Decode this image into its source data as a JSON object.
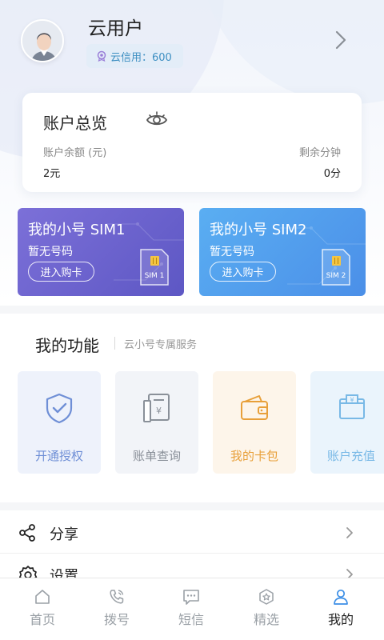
{
  "profile": {
    "username": "云用户",
    "credit_text": "云信用：600"
  },
  "overview": {
    "title": "账户总览",
    "balance_label": "账户余额 (元)",
    "balance_value": "2元",
    "minutes_label": "剩余分钟",
    "minutes_value": "0分"
  },
  "sim_cards": [
    {
      "title": "我的小号 SIM1",
      "status": "暂无号码",
      "button": "进入购卡",
      "chip_label": "SIM 1"
    },
    {
      "title": "我的小号 SIM2",
      "status": "暂无号码",
      "button": "进入购卡",
      "chip_label": "SIM 2"
    }
  ],
  "functions": {
    "title": "我的功能",
    "subtitle": "云小号专属服务",
    "items": [
      {
        "label": "开通授权",
        "icon": "shield-check-icon",
        "color": "#6f8fd6",
        "bg": "#eef2fb"
      },
      {
        "label": "账单查询",
        "icon": "bill-icon",
        "color": "#8a9099",
        "bg": "#f2f4f8"
      },
      {
        "label": "我的卡包",
        "icon": "wallet-icon",
        "color": "#e8a03a",
        "bg": "#fdf5ea"
      },
      {
        "label": "账户充值",
        "icon": "recharge-icon",
        "color": "#79b9e6",
        "bg": "#eaf4fc"
      }
    ]
  },
  "menu": [
    {
      "label": "分享",
      "icon": "share-icon"
    },
    {
      "label": "设置",
      "icon": "settings-icon"
    }
  ],
  "tabbar": {
    "active": "我的",
    "items": [
      {
        "label": "首页",
        "icon": "home-icon"
      },
      {
        "label": "拨号",
        "icon": "phone-icon"
      },
      {
        "label": "短信",
        "icon": "message-icon"
      },
      {
        "label": "精选",
        "icon": "star-badge-icon"
      },
      {
        "label": "我的",
        "icon": "user-icon"
      }
    ]
  },
  "colors": {
    "accent": "#3d8fe6",
    "sim1_gradient": [
      "#7c70d8",
      "#5d57c4"
    ],
    "sim2_gradient": [
      "#5aaef2",
      "#4b8fe8"
    ],
    "credit_text": "#3d8fc2"
  }
}
